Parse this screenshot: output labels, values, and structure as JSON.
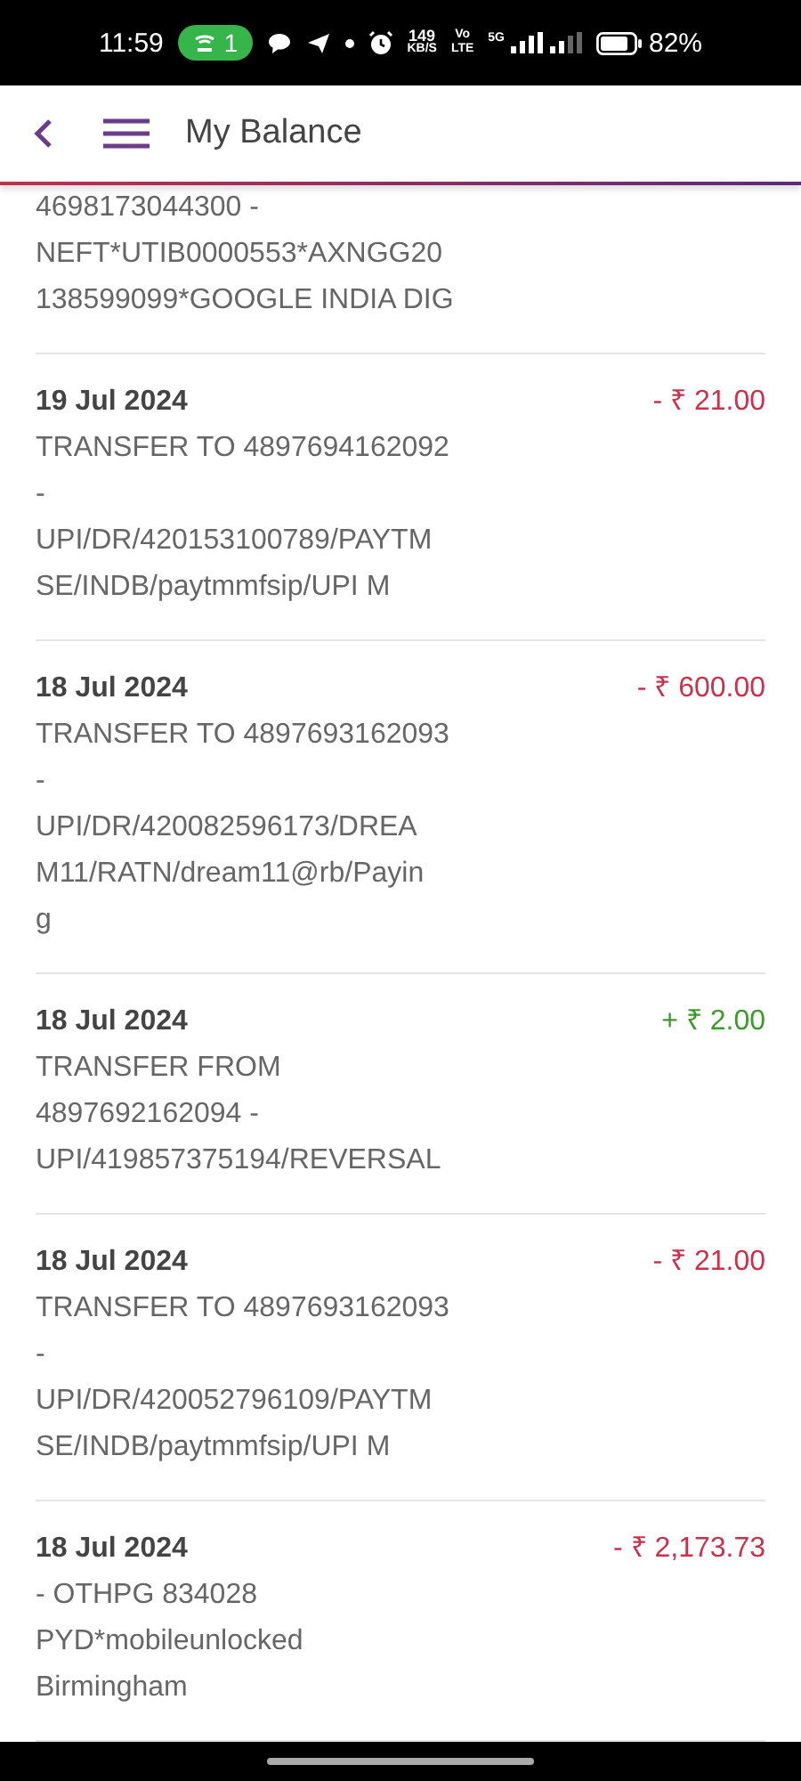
{
  "status_bar": {
    "time": "11:59",
    "hotspot_count": "1",
    "speed_value": "149",
    "speed_unit": "KB/S",
    "volte_top": "Vo",
    "volte_bottom": "LTE",
    "network": "5G",
    "battery": "82%"
  },
  "app_bar": {
    "title": "My Balance"
  },
  "transactions": [
    {
      "lines": [
        "4698173044300 -",
        "NEFT*UTIB0000553*AXNGG20",
        "138599099*GOOGLE INDIA DIG"
      ]
    },
    {
      "date": "19 Jul 2024",
      "amount": "- ₹ 21.00",
      "kind": "debit",
      "lines": [
        "TRANSFER TO 4897694162092",
        "-",
        "UPI/DR/420153100789/PAYTM",
        "SE/INDB/paytmmfsip/UPI M"
      ]
    },
    {
      "date": "18 Jul 2024",
      "amount": "- ₹ 600.00",
      "kind": "debit",
      "lines": [
        "TRANSFER TO 4897693162093",
        "-",
        "UPI/DR/420082596173/DREA",
        "M11/RATN/dream11@rb/Payin",
        "g"
      ]
    },
    {
      "date": "18 Jul 2024",
      "amount": "+ ₹ 2.00",
      "kind": "credit",
      "lines": [
        "TRANSFER FROM",
        "4897692162094 -",
        "UPI/419857375194/REVERSAL"
      ]
    },
    {
      "date": "18 Jul 2024",
      "amount": "- ₹ 21.00",
      "kind": "debit",
      "lines": [
        "TRANSFER TO 4897693162093",
        "-",
        "UPI/DR/420052796109/PAYTM",
        "SE/INDB/paytmmfsip/UPI M"
      ]
    },
    {
      "date": "18 Jul 2024",
      "amount": "- ₹ 2,173.73",
      "kind": "debit",
      "lines": [
        "- OTHPG 834028",
        "PYD*mobileunlocked",
        "Birmingham"
      ]
    }
  ]
}
